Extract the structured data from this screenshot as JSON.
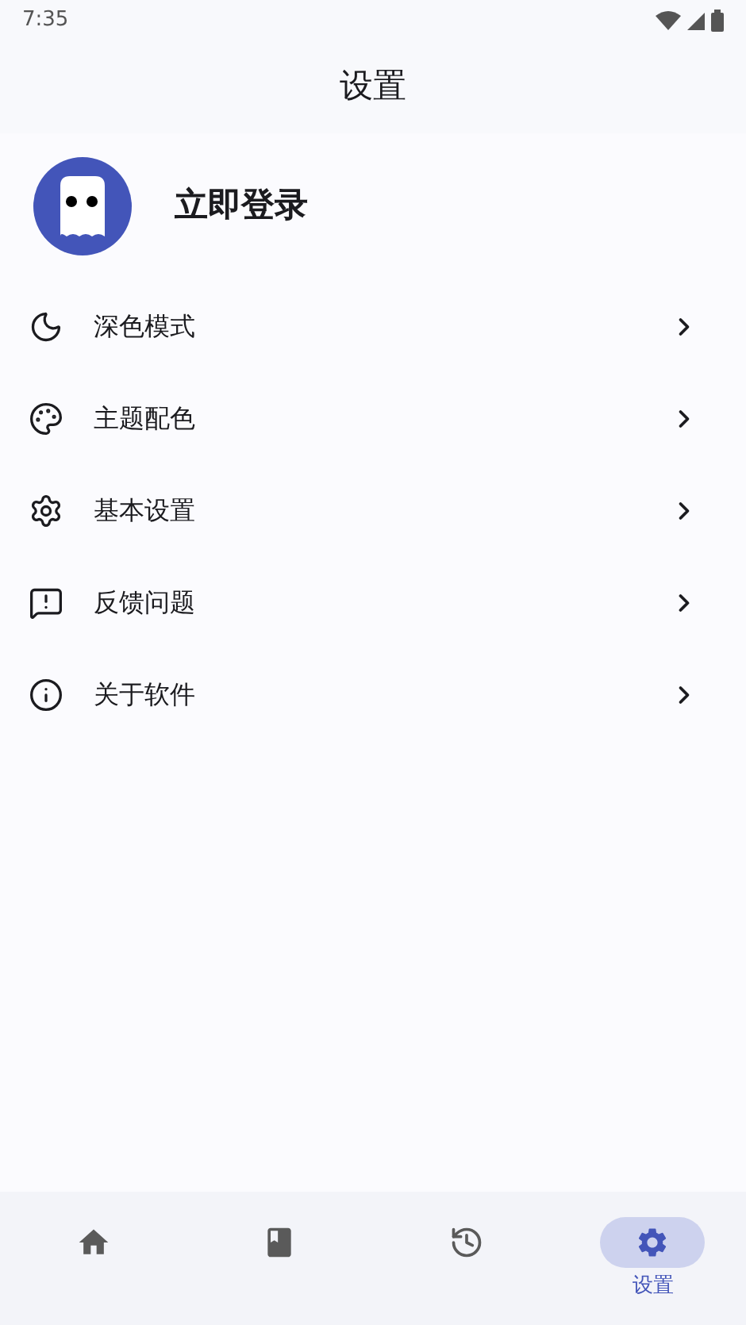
{
  "status_bar": {
    "time": "7:35"
  },
  "title": "设置",
  "profile": {
    "label": "立即登录"
  },
  "menu": [
    {
      "kind": "moon",
      "label": "深色模式"
    },
    {
      "kind": "palette",
      "label": "主题配色"
    },
    {
      "kind": "gear",
      "label": "基本设置"
    },
    {
      "kind": "feedback",
      "label": "反馈问题"
    },
    {
      "kind": "info",
      "label": "关于软件"
    }
  ],
  "nav": [
    {
      "kind": "home",
      "selected": false
    },
    {
      "kind": "book",
      "selected": false
    },
    {
      "kind": "history",
      "selected": false
    },
    {
      "kind": "gear",
      "label": "设置",
      "selected": true
    }
  ]
}
